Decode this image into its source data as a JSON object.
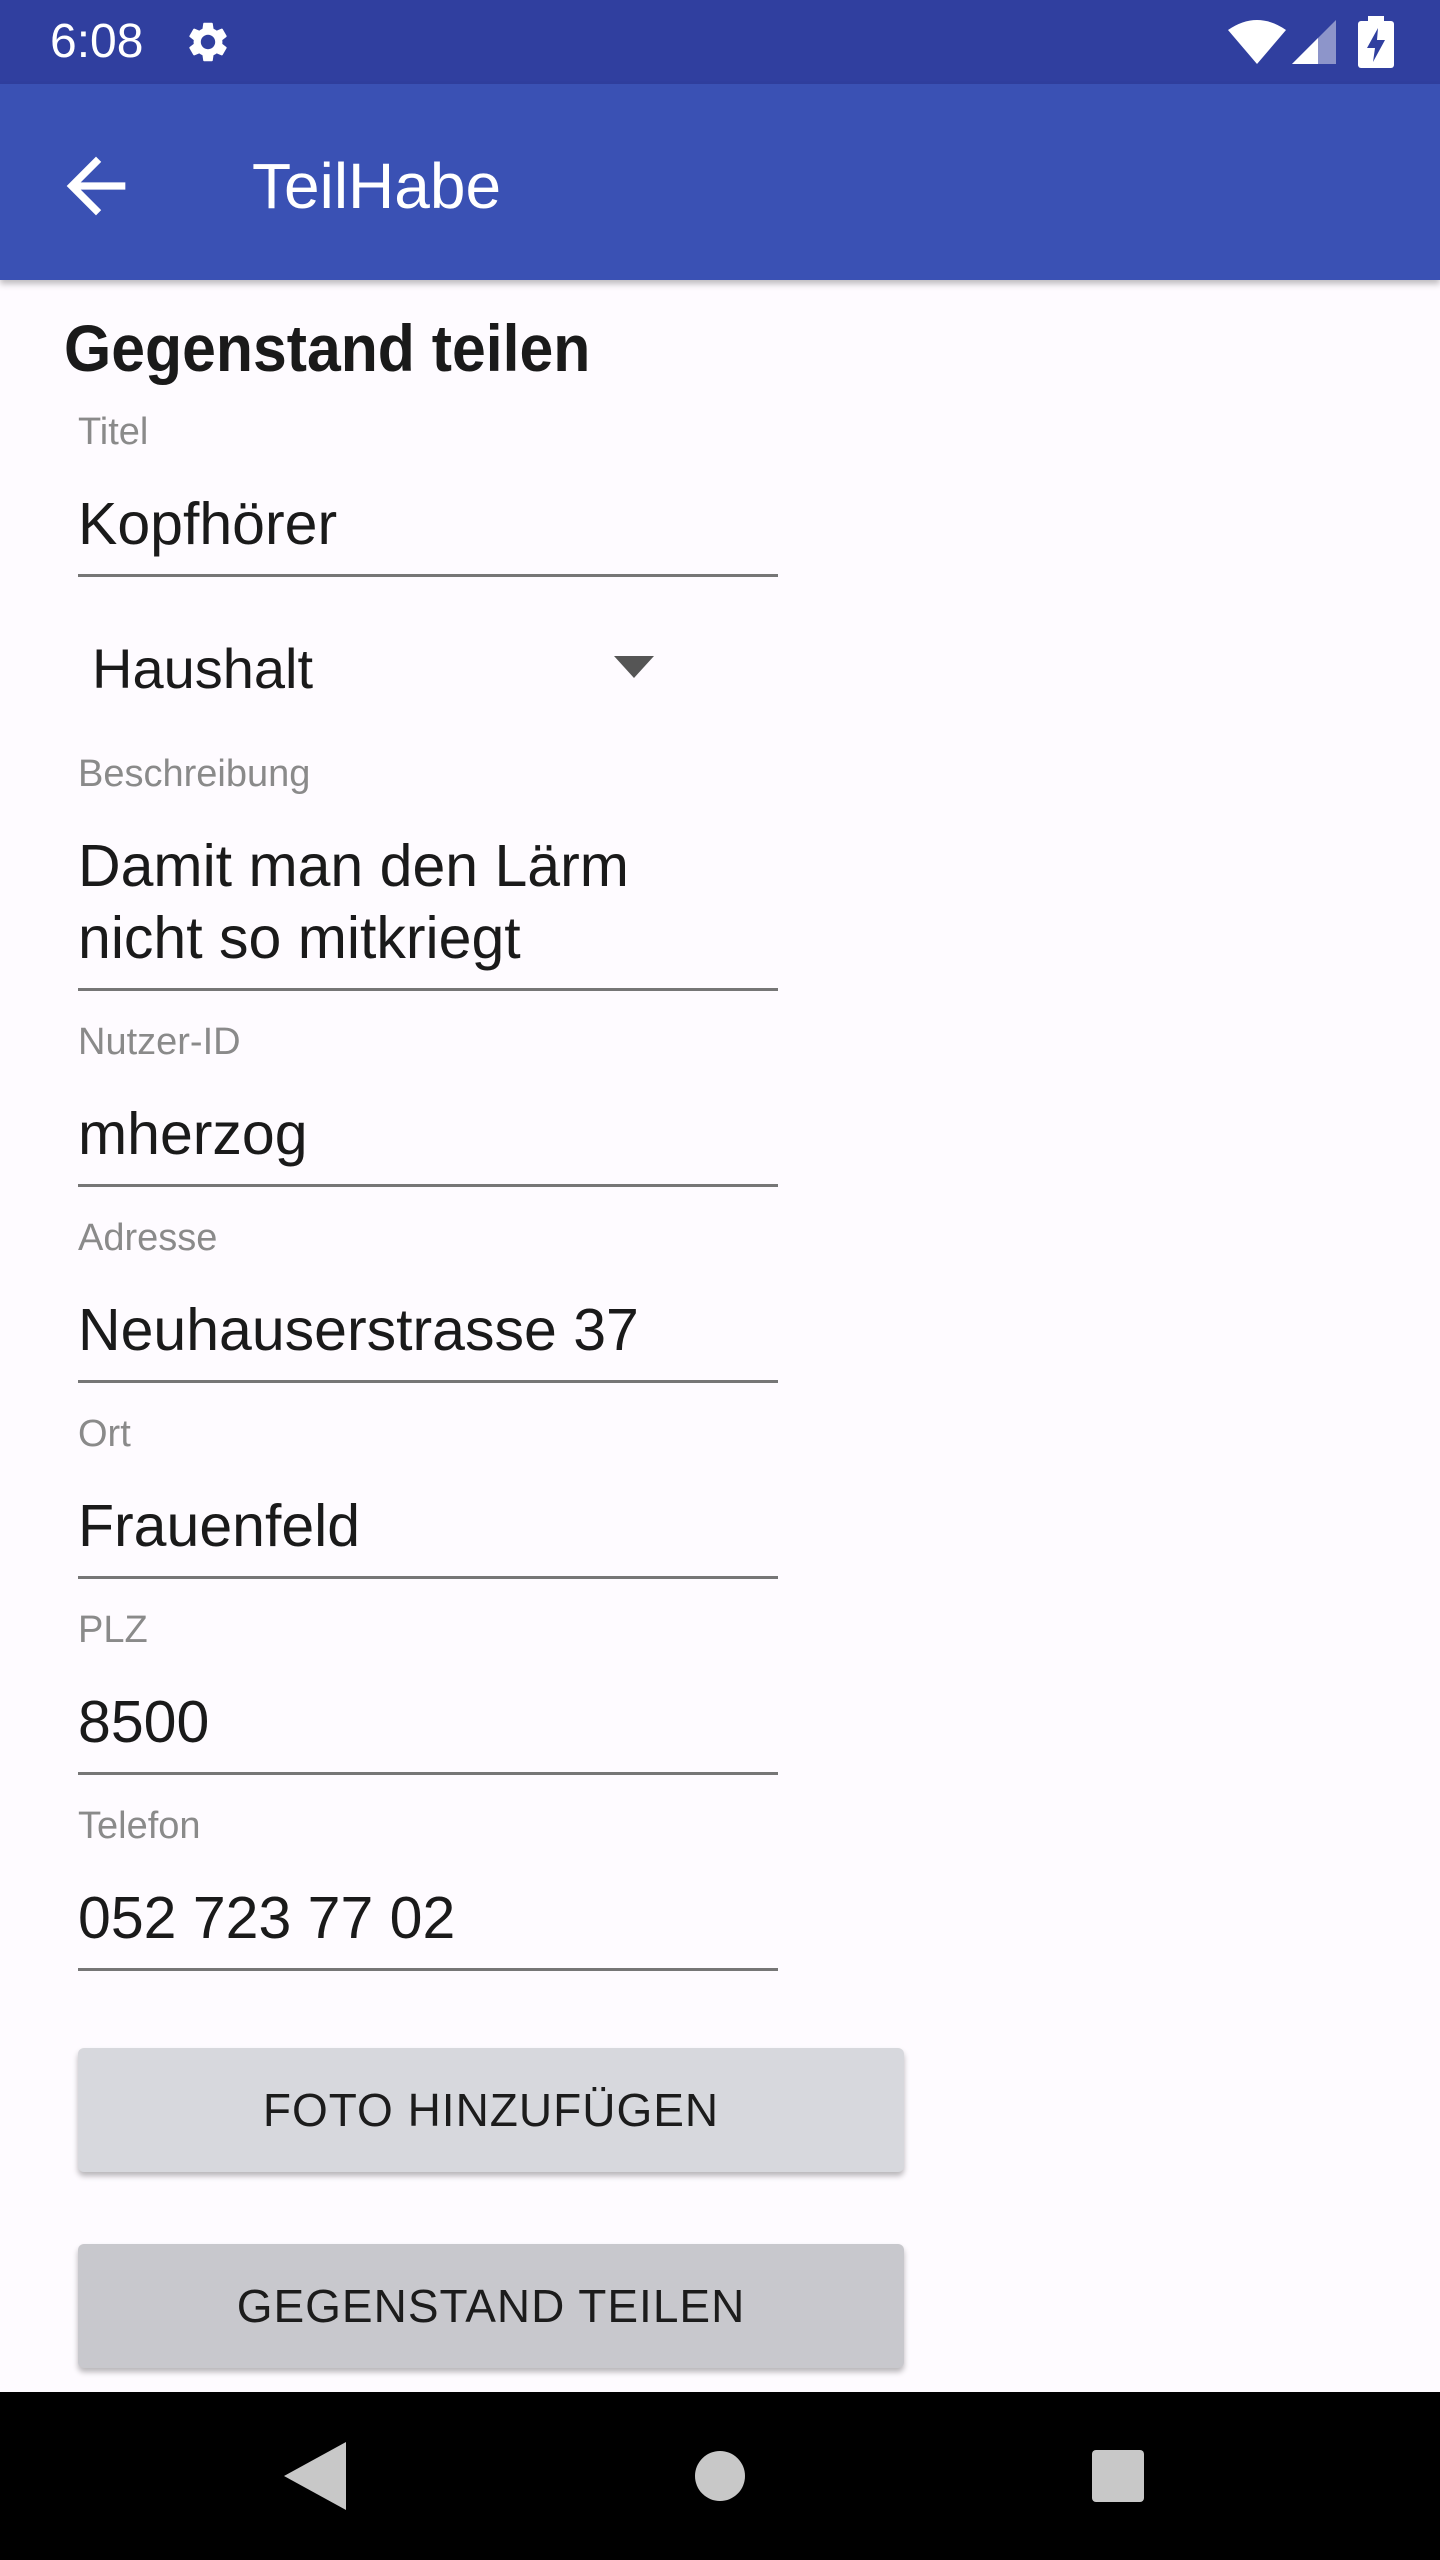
{
  "status_bar": {
    "time": "6:08",
    "icons": [
      "gear-icon",
      "wifi-icon",
      "signal-icon",
      "battery-charging-icon"
    ]
  },
  "app_bar": {
    "title": "TeilHabe",
    "back_icon": "arrow-back-icon",
    "color": "#3a51b4"
  },
  "form": {
    "section_title": "Gegenstand teilen",
    "title": {
      "label": "Titel",
      "value": "Kopfhörer"
    },
    "category": {
      "selected": "Haushalt"
    },
    "description": {
      "label": "Beschreibung",
      "value_line1": "Damit man den Lärm",
      "value_line2": "nicht so mitkriegt"
    },
    "user_id": {
      "label": "Nutzer-ID",
      "value": "mherzog"
    },
    "address": {
      "label": "Adresse",
      "value": "Neuhauserstrasse 37"
    },
    "city": {
      "label": "Ort",
      "value": "Frauenfeld"
    },
    "zip": {
      "label": "PLZ",
      "value": "8500"
    },
    "phone": {
      "label": "Telefon",
      "value": "052 723 77 02"
    }
  },
  "buttons": {
    "add_photo": "FOTO HINZUFÜGEN",
    "share_item": "GEGENSTAND TEILEN"
  },
  "nav_bar": {
    "icons": [
      "nav-back-icon",
      "nav-home-icon",
      "nav-recent-icon"
    ]
  }
}
